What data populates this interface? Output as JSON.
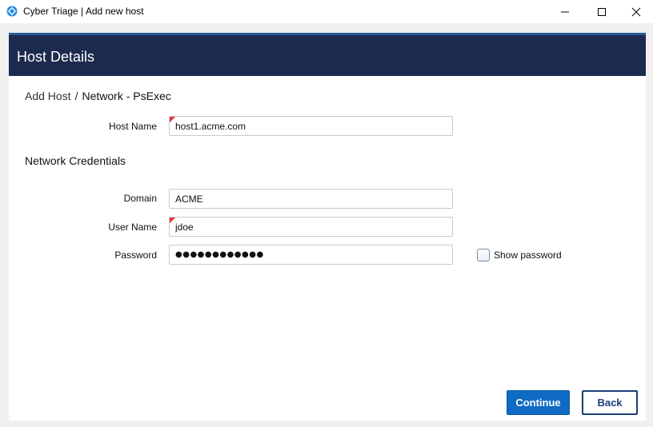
{
  "window": {
    "title": "Cyber Triage | Add new host",
    "app_icon": "cyber-triage-logo-icon",
    "controls": [
      "minimize-icon",
      "maximize-icon",
      "close-icon"
    ]
  },
  "header": {
    "title": "Host Details"
  },
  "breadcrumb": {
    "items": [
      "Add Host",
      "Network - PsExec"
    ],
    "separator": "/"
  },
  "host": {
    "label": "Host Name",
    "value": "host1.acme.com",
    "required": true
  },
  "credentials": {
    "title": "Network Credentials",
    "domain": {
      "label": "Domain",
      "value": "ACME"
    },
    "user": {
      "label": "User Name",
      "value": "jdoe",
      "required": true
    },
    "password": {
      "label": "Password",
      "value": "●●●●●●●●●●●●"
    },
    "show_password": {
      "label": "Show password",
      "checked": false
    }
  },
  "actions": {
    "continue_label": "Continue",
    "back_label": "Back"
  },
  "colors": {
    "header_bg": "#1b2a4e",
    "header_accent": "#2b579a",
    "primary": "#0f6bc4",
    "secondary_border": "#1a3f78",
    "required_marker": "#e53935"
  }
}
